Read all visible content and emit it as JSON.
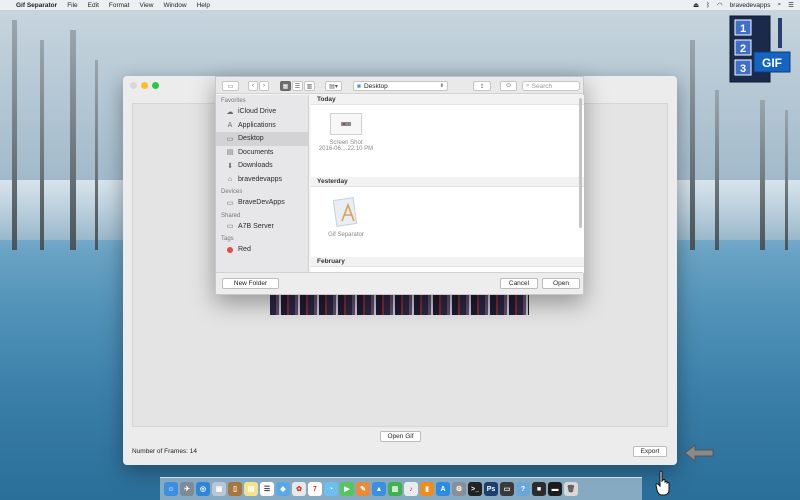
{
  "menubar": {
    "apple": "",
    "app_name": "Gif Separator",
    "menus": [
      "File",
      "Edit",
      "Format",
      "View",
      "Window",
      "Help"
    ],
    "user": "bravedevapps"
  },
  "dialog": {
    "location": "Desktop",
    "search_placeholder": "Search",
    "sidebar": {
      "favorites_label": "Favorites",
      "favorites": [
        {
          "label": "iCloud Drive",
          "icon": "cloud-icon"
        },
        {
          "label": "Applications",
          "icon": "applications-icon"
        },
        {
          "label": "Desktop",
          "icon": "desktop-icon",
          "selected": true
        },
        {
          "label": "Documents",
          "icon": "documents-icon"
        },
        {
          "label": "Downloads",
          "icon": "downloads-icon"
        },
        {
          "label": "bravedevapps",
          "icon": "home-icon"
        }
      ],
      "devices_label": "Devices",
      "devices": [
        {
          "label": "BraveDevApps",
          "icon": "disk-icon"
        }
      ],
      "shared_label": "Shared",
      "shared": [
        {
          "label": "A7B Server",
          "icon": "server-icon"
        }
      ],
      "tags_label": "Tags",
      "tags": [
        {
          "label": "Red",
          "color": "#e5484d"
        }
      ]
    },
    "groups": {
      "today": {
        "label": "Today",
        "file_name": "Screen Shot",
        "file_date": "2016-06....22.10 PM"
      },
      "yesterday": {
        "label": "Yesterday",
        "file_name": "Gif Separator"
      },
      "february": {
        "label": "February"
      }
    },
    "new_folder_label": "New Folder",
    "cancel_label": "Cancel",
    "open_label": "Open"
  },
  "main_window": {
    "open_gif_label": "Open Gif",
    "frames_label": "Number of Frames: 14",
    "export_label": "Export"
  },
  "colors": {
    "close": "#ff5f57",
    "minimize": "#febc2e",
    "zoom": "#28c840",
    "tag_red": "#e5484d"
  }
}
